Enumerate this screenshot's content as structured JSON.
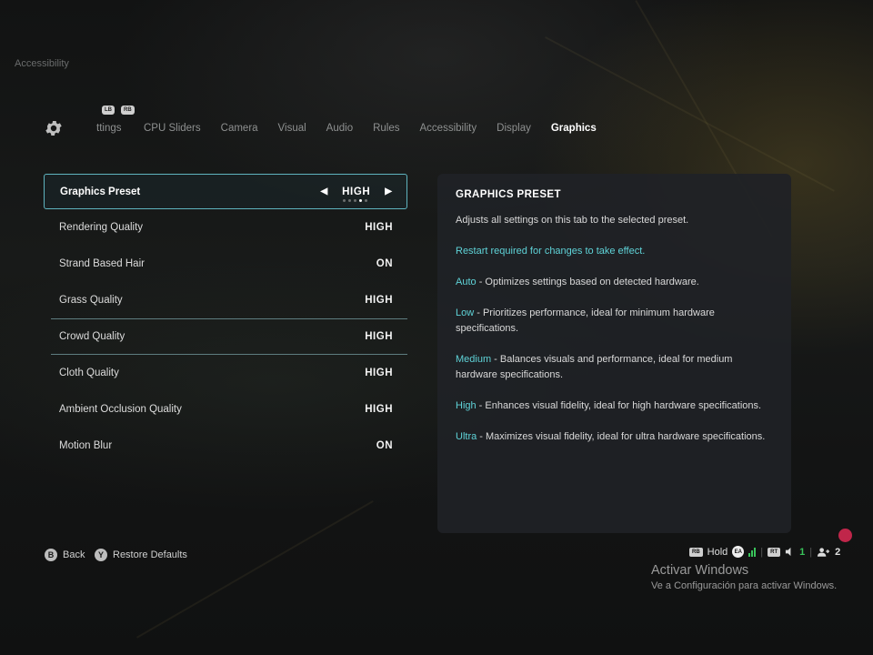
{
  "breadcrumb": "Accessibility",
  "bumpers": {
    "left": "LB",
    "right": "RB"
  },
  "tabs": [
    {
      "label": "Settings",
      "visible_label": "ttings"
    },
    {
      "label": "CPU Sliders"
    },
    {
      "label": "Camera"
    },
    {
      "label": "Visual"
    },
    {
      "label": "Audio"
    },
    {
      "label": "Rules"
    },
    {
      "label": "Accessibility"
    },
    {
      "label": "Display"
    },
    {
      "label": "Graphics"
    }
  ],
  "active_tab": "Graphics",
  "settings": [
    {
      "label": "Graphics Preset",
      "value": "HIGH",
      "selected": true,
      "preset_dots": 5,
      "preset_index": 3
    },
    {
      "label": "Rendering Quality",
      "value": "HIGH"
    },
    {
      "label": "Strand Based Hair",
      "value": "ON"
    },
    {
      "label": "Grass Quality",
      "value": "HIGH"
    },
    {
      "label": "Crowd Quality",
      "value": "HIGH"
    },
    {
      "label": "Cloth Quality",
      "value": "HIGH"
    },
    {
      "label": "Ambient Occlusion Quality",
      "value": "HIGH"
    },
    {
      "label": "Motion Blur",
      "value": "ON"
    }
  ],
  "panel": {
    "title": "GRAPHICS PRESET",
    "description": "Adjusts all settings on this tab to the selected preset.",
    "restart_note": "Restart required for changes to take effect.",
    "presets": [
      {
        "name": "Auto",
        "text": " - Optimizes settings based on detected hardware."
      },
      {
        "name": "Low",
        "text": " - Prioritizes performance, ideal for minimum hardware specifications."
      },
      {
        "name": "Medium",
        "text": " - Balances visuals and performance, ideal for medium hardware specifications."
      },
      {
        "name": "High",
        "text": " - Enhances visual fidelity, ideal for high hardware specifications."
      },
      {
        "name": "Ultra",
        "text": " - Maximizes visual fidelity, ideal for ultra hardware specifications."
      }
    ]
  },
  "footer": {
    "back": {
      "button": "B",
      "label": "Back"
    },
    "restore": {
      "button": "Y",
      "label": "Restore Defaults"
    }
  },
  "status": {
    "rb_badge": "RB",
    "hold_label": "Hold",
    "ea_badge": "EA",
    "rt_badge": "RT",
    "connected_count": "1",
    "players_count": "2"
  },
  "windows": {
    "title": "Activar Windows",
    "subtitle": "Ve a Configuración para activar Windows."
  },
  "colors": {
    "accent_teal": "#5fd3d8",
    "selected_border": "#5fb4bf",
    "status_green": "#39c35a",
    "notification_red": "#c0264a"
  }
}
